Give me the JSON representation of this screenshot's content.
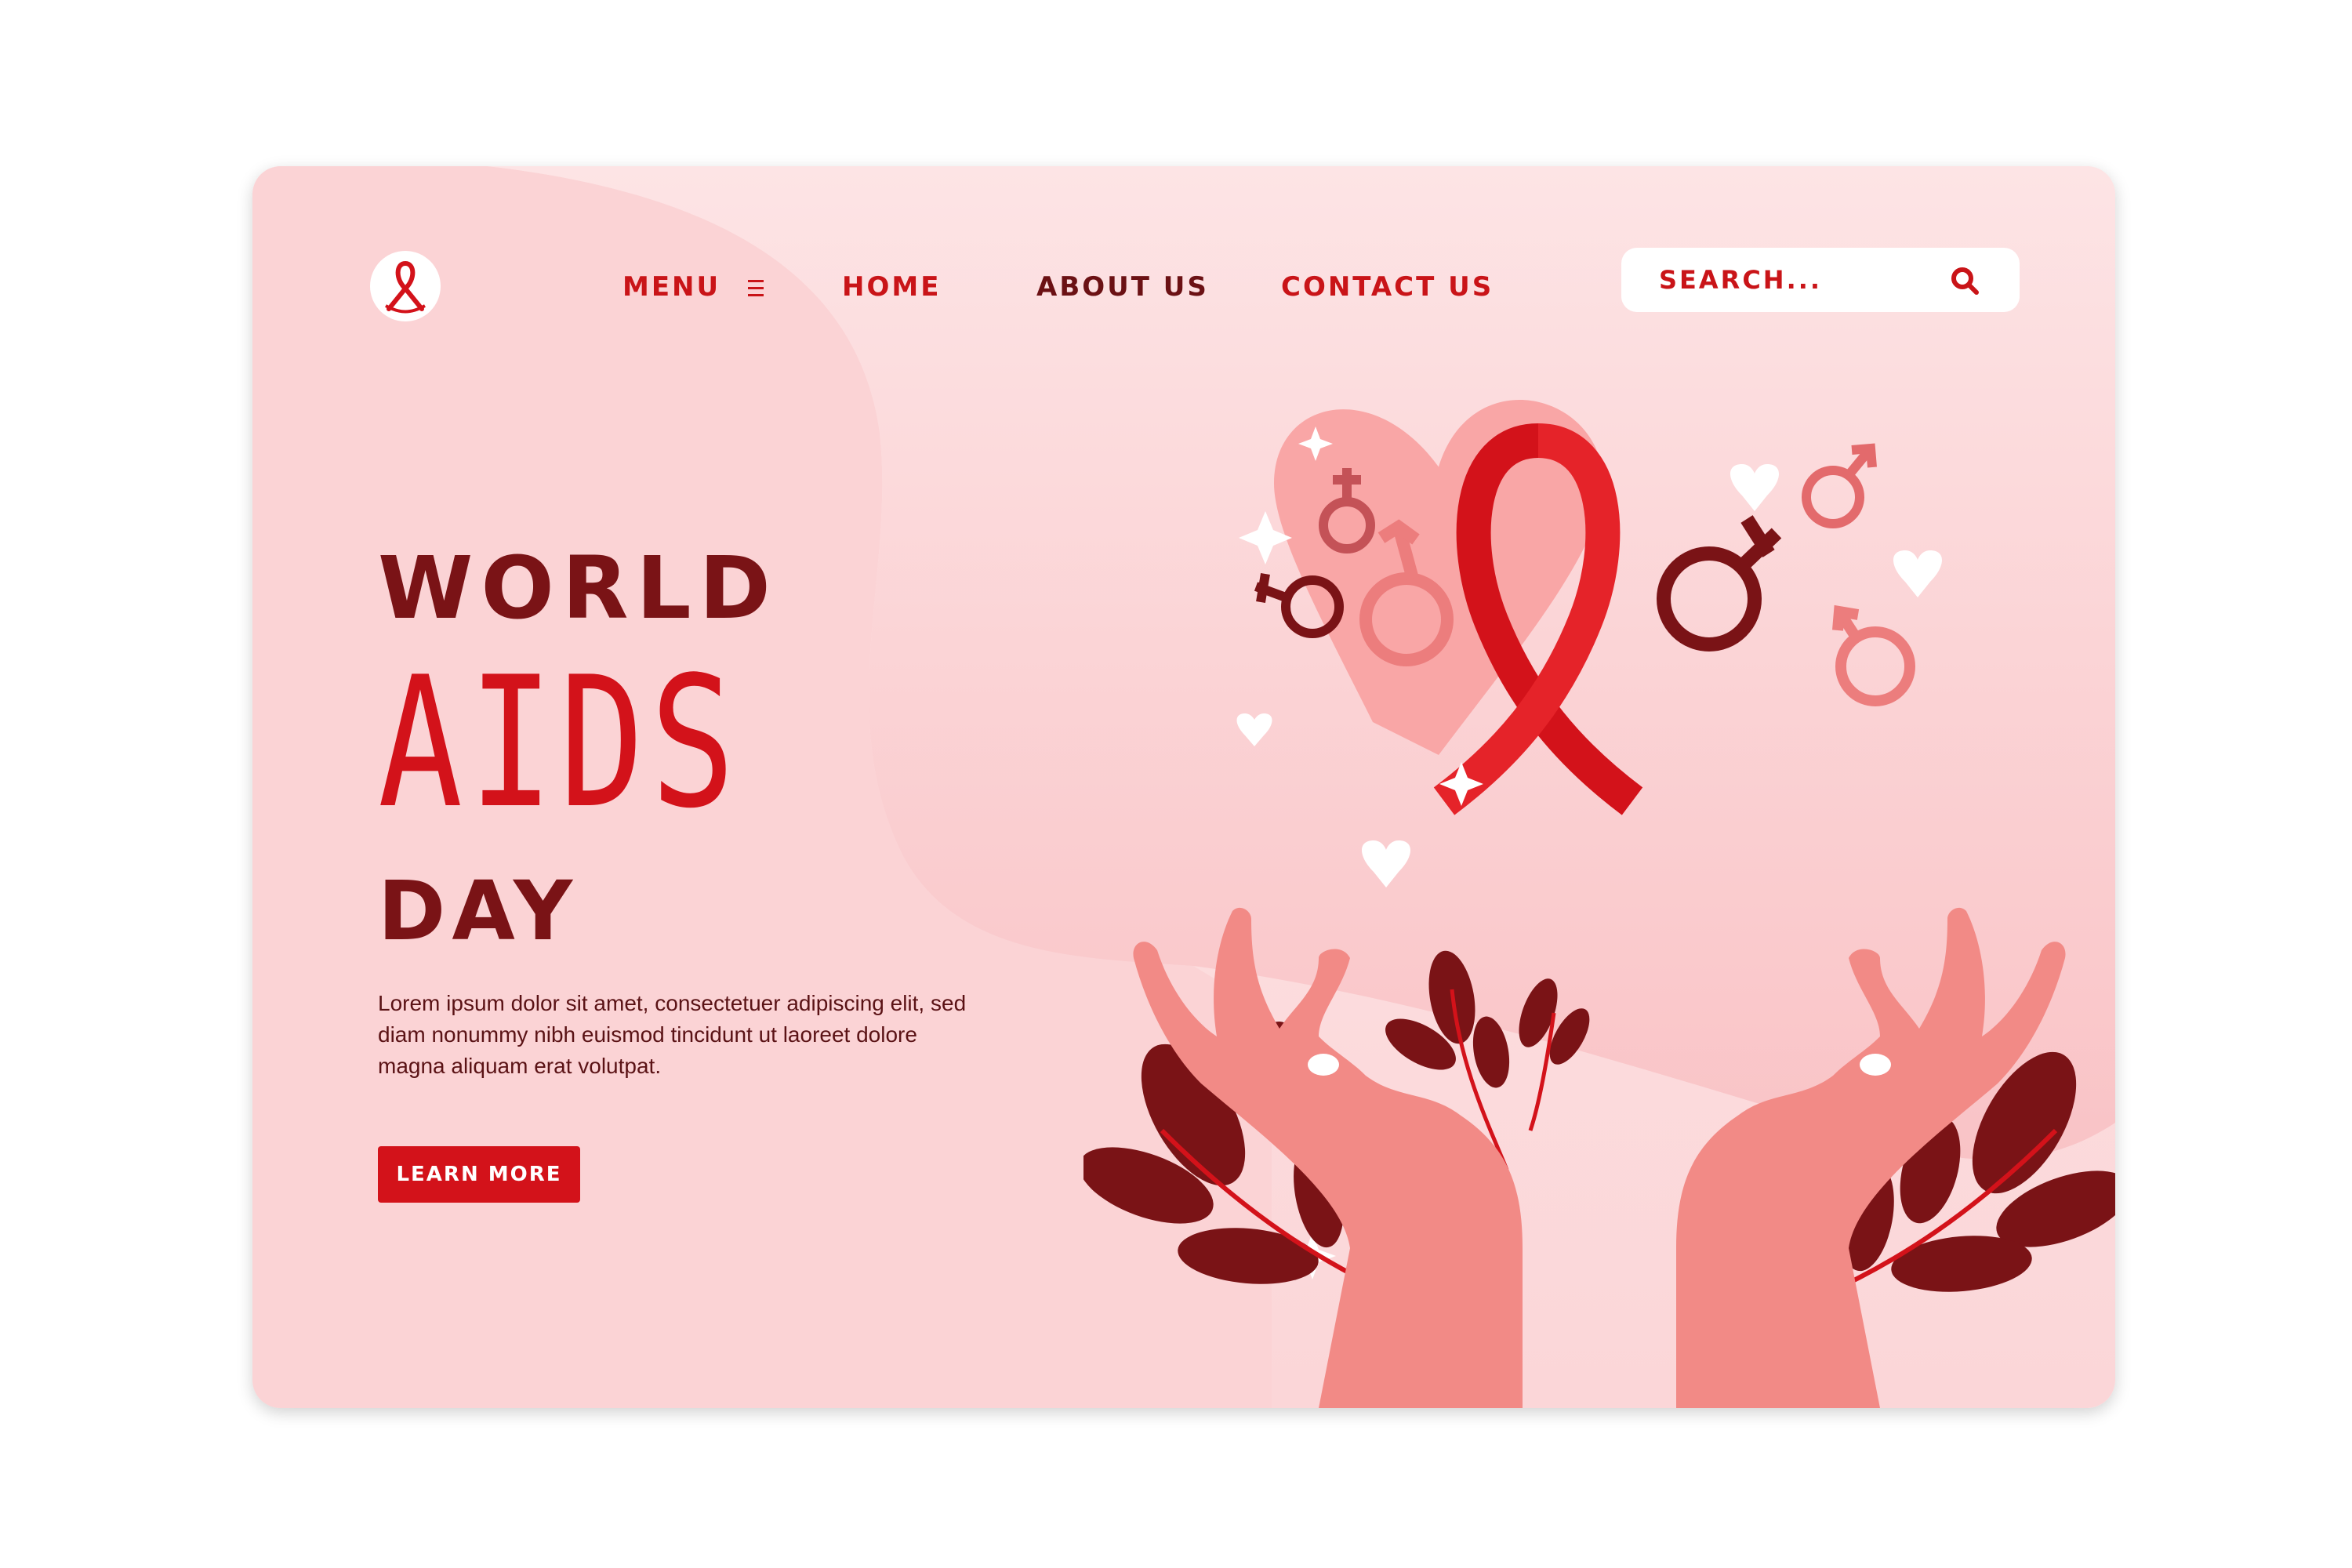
{
  "nav": {
    "menu_label": "MENU",
    "home_label": "HOME",
    "about_label": "ABOUT US",
    "contact_label": "CONTACT US"
  },
  "search": {
    "placeholder": "SEARCH..."
  },
  "hero": {
    "title_line1": "WORLD",
    "title_line2": "AIDS",
    "title_line3": "DAY",
    "body": "Lorem ipsum dolor sit amet, consectetuer adipiscing elit, sed diam nonummy nibh euismod tincidunt ut laoreet dolore magna aliquam erat volutpat.",
    "cta_label": "LEARN MORE"
  },
  "colors": {
    "accent": "#d3121a",
    "dark": "#7a1316",
    "background": "#fde6e7",
    "skin": "#f28a86"
  },
  "icons": [
    "ribbon-logo-icon",
    "menu-icon",
    "search-icon"
  ]
}
